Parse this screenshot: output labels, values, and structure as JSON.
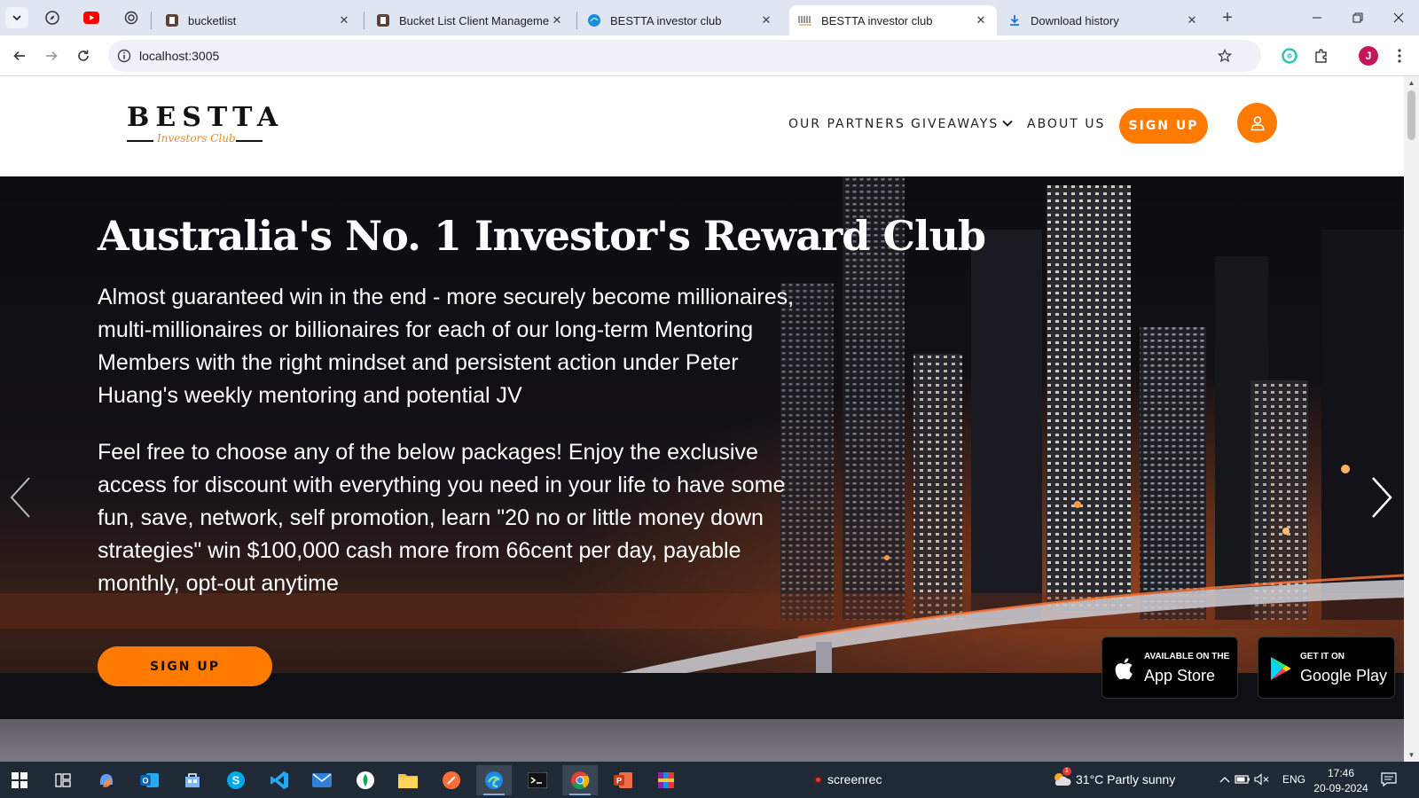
{
  "browser": {
    "pinned_tabs": [
      "compass-icon",
      "youtube-icon",
      "chatgpt-icon"
    ],
    "tabs": [
      {
        "title": "bucketlist",
        "icon": "bucketlist-favicon-icon"
      },
      {
        "title": "Bucket List Client Management",
        "icon": "bucketlist-favicon-icon"
      },
      {
        "title": "BESTTA investor club",
        "icon": "edge-favicon-icon"
      },
      {
        "title": "BESTTA investor club",
        "icon": "bestta-favicon-icon",
        "active": true
      },
      {
        "title": "Download history",
        "icon": "download-icon"
      }
    ],
    "url": "localhost:3005",
    "profile_initial": "J"
  },
  "site": {
    "logo": {
      "main": "BESTTA",
      "sub": "Investors Club"
    },
    "nav": {
      "partners": "OUR PARTNERS",
      "giveaways": "GIVEAWAYS",
      "about": "ABOUT US",
      "signup": "SIGN UP"
    },
    "hero": {
      "title": "Australia's No. 1 Investor's Reward Club",
      "paragraph1": "Almost guaranteed win in the end - more securely become millionaires, multi-millionaires or billionaires for each of our long-term Mentoring Members with the right mindset and persistent action under Peter Huang's weekly mentoring and potential JV",
      "paragraph2": "Feel free to choose any of the below packages! Enjoy the exclusive access for discount with everything you need in your life to have some fun, save, network, self promotion, learn \"20 no or little money down strategies\" win $100,000 cash more from 66cent per day, payable monthly, opt-out anytime",
      "cta": "SIGN UP"
    },
    "badges": {
      "appstore": {
        "small": "AVAILABLE ON THE",
        "big": "App Store"
      },
      "googleplay": {
        "small": "GET IT ON",
        "big": "Google Play"
      }
    }
  },
  "taskbar": {
    "screenrec": "screenrec",
    "weather": "31°C  Partly sunny",
    "weather_badge": "1",
    "lang": "ENG",
    "time": "17:46",
    "date": "20-09-2024"
  },
  "colors": {
    "accent": "#ff7a00",
    "tabstrip": "#dfe6f2",
    "taskbar": "#1f2a36"
  }
}
